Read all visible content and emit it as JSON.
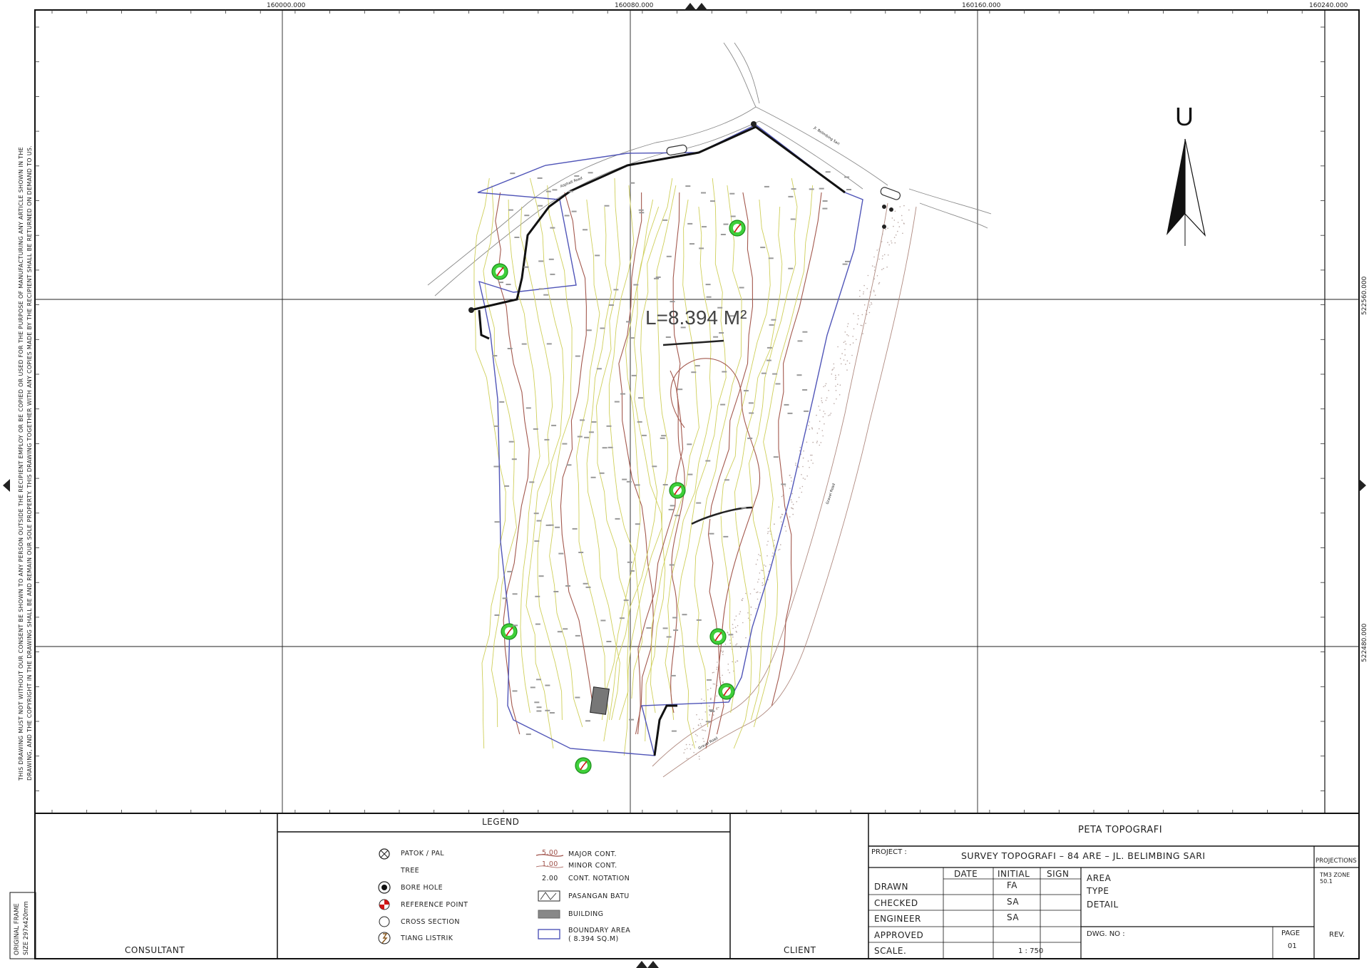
{
  "sheet": {
    "coords_top": [
      "160000.000",
      "160080.000",
      "160160.000",
      "160240.000"
    ],
    "coords_right": [
      "522560.000",
      "522480.000"
    ],
    "disclaimer_lines": [
      "THIS DRAWING MUST NOT WITHOUT OUR CONSENT BE SHOWN TO ANY PERSON OUTSIDE THE RECIPIENT EMPLOY OR BE COPIED OR USED FOR THE PURPOSE OF MANUFACTURING ANY ARTICLE SHOWN IN THE",
      "DRAWING, AND THE COPYRIGHT IN THE DRAWING SHALL BE AND REMAIN OUR SOLE PROPERTY. THIS DRAWING TOGETHER WITH ANY COPIES MADE BY THE RECIPIENT SHALL BE RETURNED ON DEMAND TO US."
    ],
    "original_frame_lines": [
      "ORIGINAL FRAME",
      "SIZE 297x420mm"
    ]
  },
  "map": {
    "area_label": "L=8.394 M²",
    "north_label": "U",
    "road_labels": [
      "Asphalt Road",
      "Jl. Belimbing Sari",
      "Gravel Road",
      "Gravel Road"
    ]
  },
  "legend": {
    "title": "LEGEND",
    "items_left": [
      "PATOK / PAL",
      "TREE",
      "BORE HOLE",
      "REFERENCE POINT",
      "CROSS SECTION",
      "TIANG LISTRIK"
    ],
    "major_sample": "5.00",
    "major_label": "MAJOR CONT.",
    "minor_sample": "1.00",
    "minor_label": "MINOR CONT.",
    "notation_sample": "2.00",
    "notation_label": "CONT. NOTATION",
    "pasangan_label": "PASANGAN BATU",
    "building_label": "BUILDING",
    "boundary_label": "BOUNDARY AREA",
    "boundary_value": "( 8.394  SQ.M)"
  },
  "titleblock": {
    "consultant": "CONSULTANT",
    "client": "CLIENT",
    "title": "PETA TOPOGRAFI",
    "project_label": "PROJECT :",
    "project_name": "SURVEY TOPOGRAFI  –  84 ARE  –  JL. BELIMBING SARI",
    "projections_label": "PROJECTIONS",
    "projections_value1": "TM3 ZONE",
    "projections_value2": "50.1",
    "col_date": "DATE",
    "col_initial": "INITIAL",
    "col_sign": "SIGN",
    "rows": [
      {
        "label": "DRAWN",
        "initial": "FA"
      },
      {
        "label": "CHECKED",
        "initial": "SA"
      },
      {
        "label": "ENGINEER",
        "initial": "SA"
      },
      {
        "label": "APPROVED",
        "initial": ""
      }
    ],
    "scale_label": "SCALE.",
    "scale_value": "1 : 750",
    "area_label": "AREA",
    "type_label": "TYPE",
    "detail_label": "DETAIL",
    "dwg_label": "DWG. NO :",
    "page_label": "PAGE",
    "page_value": "01",
    "rev_label": "REV."
  }
}
